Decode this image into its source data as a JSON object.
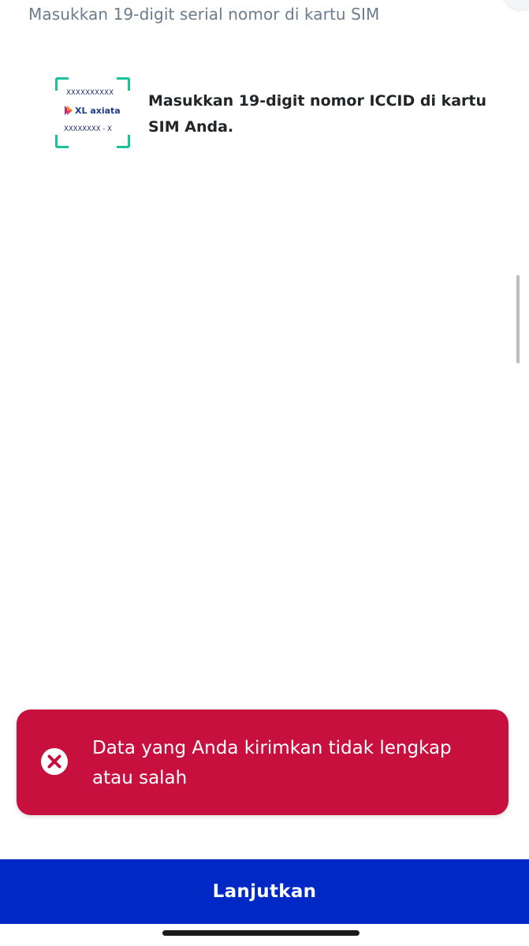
{
  "header": {
    "subtitle": "Masukkan 19-digit serial nomor di kartu SIM"
  },
  "instruction": {
    "text": "Masukkan 19-digit nomor ICCID di kartu SIM Anda.",
    "illustration": {
      "serial_top": "XXXXXXXXXX",
      "serial_bottom": "XXXXXXXX - X",
      "brand": "XL axiata",
      "brand_colors": [
        "#f7941d",
        "#b5268e",
        "#1f3c8a"
      ],
      "frame_color": "#19c29a"
    }
  },
  "toast": {
    "message": "Data yang Anda kirimkan tidak lengkap atau salah",
    "icon": "close-circle-icon",
    "background": "#c8103f"
  },
  "footer": {
    "continue_label": "Lanjutkan",
    "background": "#0028c5"
  }
}
